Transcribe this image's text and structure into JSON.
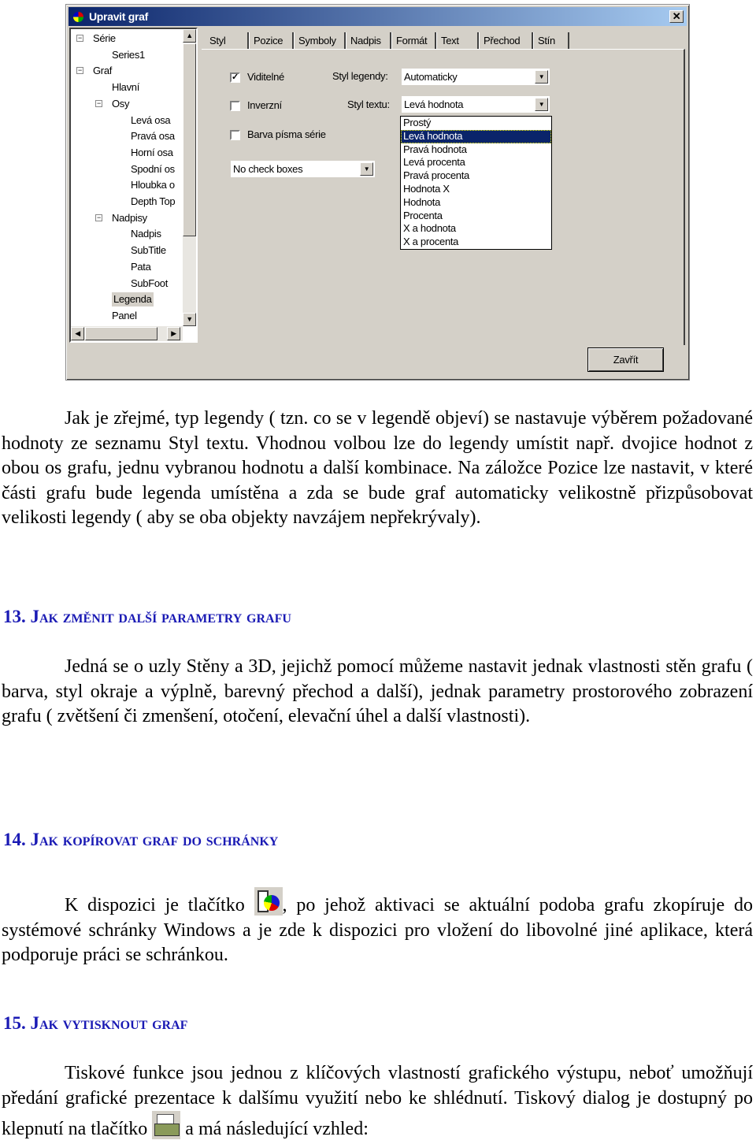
{
  "dialog": {
    "title": "Upravit graf",
    "close_glyph": "✕",
    "tree": [
      {
        "label": "Série",
        "level": 0,
        "expand": "−"
      },
      {
        "label": "Series1",
        "level": 1
      },
      {
        "label": "Graf",
        "level": 0,
        "expand": "−"
      },
      {
        "label": "Hlavní",
        "level": 1
      },
      {
        "label": "Osy",
        "level": 1,
        "expand": "−"
      },
      {
        "label": "Levá osa",
        "level": 2
      },
      {
        "label": "Pravá osa",
        "level": 2
      },
      {
        "label": "Horní osa",
        "level": 2
      },
      {
        "label": "Spodní os",
        "level": 2
      },
      {
        "label": "Hloubka o",
        "level": 2
      },
      {
        "label": "Depth Top",
        "level": 2
      },
      {
        "label": "Nadpisy",
        "level": 1,
        "expand": "−"
      },
      {
        "label": "Nadpis",
        "level": 2
      },
      {
        "label": "SubTitle",
        "level": 2
      },
      {
        "label": "Pata",
        "level": 2
      },
      {
        "label": "SubFoot",
        "level": 2
      },
      {
        "label": "Legenda",
        "level": 1,
        "selected": true
      },
      {
        "label": "Panel",
        "level": 1
      }
    ],
    "tabs": [
      "Styl",
      "Pozice",
      "Symboly",
      "Nadpis",
      "Formát",
      "Text",
      "Přechod",
      "Stín"
    ],
    "active_tab": "Styl",
    "checkboxes": [
      {
        "label": "Viditelné",
        "checked": true
      },
      {
        "label": "Inverzní",
        "checked": false
      },
      {
        "label": "Barva písma série",
        "checked": false
      }
    ],
    "legend_style": {
      "label": "Styl legendy:",
      "value": "Automaticky"
    },
    "text_style": {
      "label": "Styl textu:",
      "value": "Levá hodnota",
      "options": [
        "Prostý",
        "Levá hodnota",
        "Pravá hodnota",
        "Levá procenta",
        "Pravá procenta",
        "Hodnota X",
        "Hodnota",
        "Procenta",
        "X a hodnota",
        "X a procenta"
      ],
      "highlighted": 1
    },
    "checkbox_mode": {
      "value": "No check boxes"
    },
    "close_button": "Zavřít",
    "colors": {
      "titlebar": "#0a246a",
      "highlight": "#0a246a",
      "face": "#d4d0c8"
    }
  },
  "doc": {
    "p1": "Jak je zřejmé, typ legendy ( tzn. co se v legendě objeví) se nastavuje výběrem požadované hodnoty ze seznamu Styl textu. Vhodnou volbou lze do legendy umístit např. dvojice hodnot z obou os grafu, jednu vybranou hodnotu a další kombinace. Na záložce Pozice lze nastavit, v které části grafu bude legenda umístěna a zda se bude graf automaticky velikostně přizpůsobovat velikosti legendy ( aby se oba objekty navzájem nepřekrývaly).",
    "h13": "13. Jak změnit další parametry grafu",
    "p2": "Jedná se o uzly Stěny a 3D, jejichž pomocí můžeme nastavit jednak vlastnosti stěn grafu ( barva, styl okraje a výplně, barevný přechod a další), jednak parametry prostorového zobrazení grafu ( zvětšení či zmenšení, otočení, elevační úhel a další vlastnosti).",
    "h14": "14. Jak kopírovat graf do schránky",
    "p3a": "K dispozici je tlačítko ",
    "p3b": ", po jehož aktivaci se aktuální podoba grafu zkopíruje do systémové schránky Windows a je zde k dispozici pro vložení do libovolné jiné aplikace, která podporuje práci se schránkou.",
    "h15": "15. Jak vytisknout graf",
    "p4a": "Tiskové funkce jsou jednou z klíčových vlastností grafického výstupu, neboť umožňují předání grafické prezentace k dalšímu využití nebo ke shlédnutí. Tiskový dialog je dostupný po klepnutí na tlačítko ",
    "p4b": " a má následující vzhled:",
    "heading_color": "#1a1ab4"
  }
}
